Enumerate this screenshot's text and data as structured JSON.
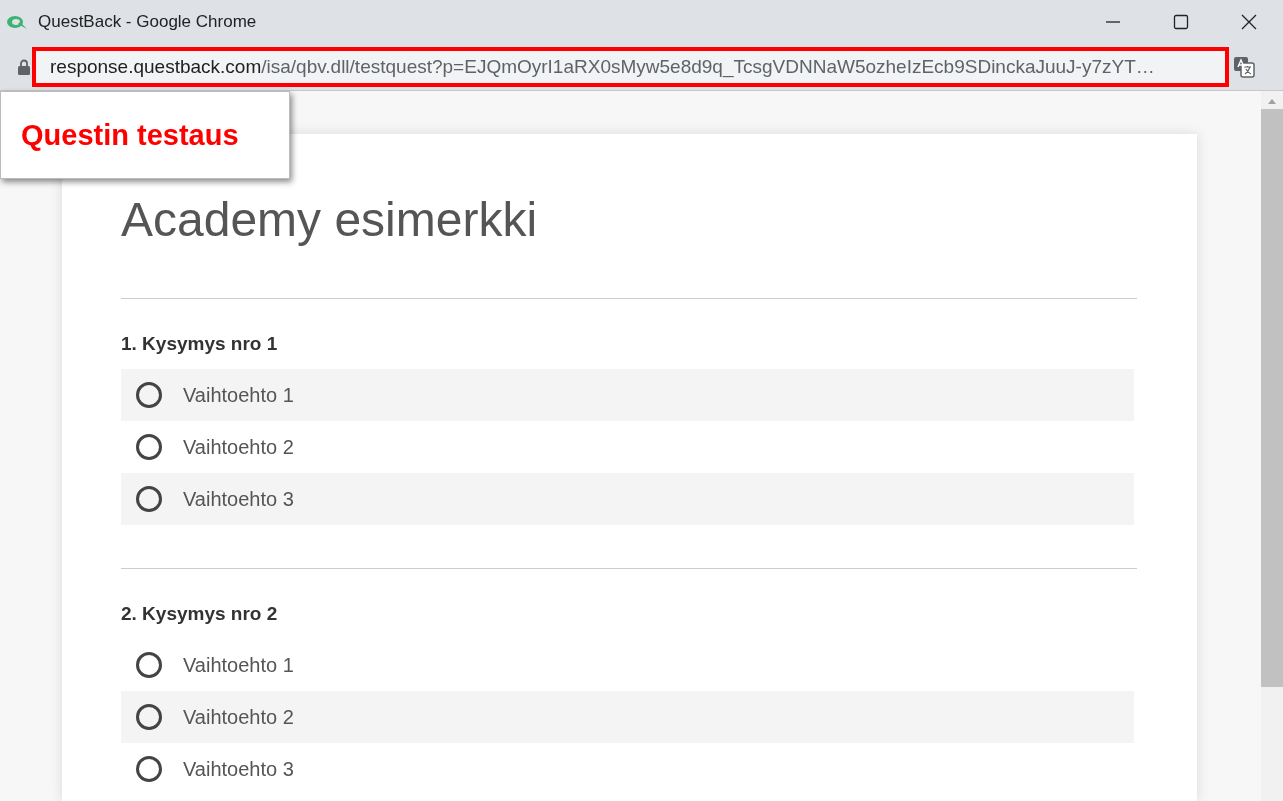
{
  "window": {
    "title": "QuestBack - Google Chrome"
  },
  "address_bar": {
    "host": "response.questback.com",
    "path": "/isa/qbv.dll/testquest?p=EJQmOyrI1aRX0sMyw5e8d9q_TcsgVDNNaW5ozheIzEcb9SDinckaJuuJ-y7zYT…"
  },
  "callout": {
    "text": "Questin testaus"
  },
  "survey": {
    "title": "Academy esimerkki",
    "questions": [
      {
        "heading": "1. Kysymys nro 1",
        "options": [
          {
            "label": "Vaihtoehto 1",
            "selected": false
          },
          {
            "label": "Vaihtoehto 2",
            "selected": false
          },
          {
            "label": "Vaihtoehto 3",
            "selected": false
          }
        ]
      },
      {
        "heading": "2. Kysymys nro 2",
        "options": [
          {
            "label": "Vaihtoehto 1",
            "selected": false
          },
          {
            "label": "Vaihtoehto 2",
            "selected": false
          },
          {
            "label": "Vaihtoehto 3",
            "selected": false
          }
        ]
      }
    ]
  }
}
